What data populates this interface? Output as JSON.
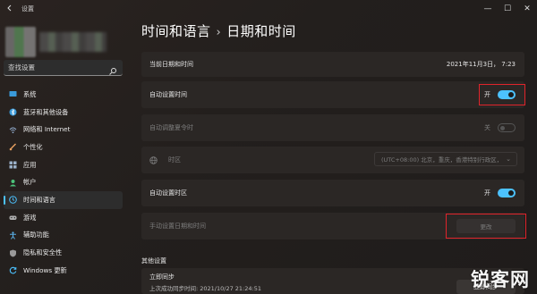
{
  "titlebar": {
    "title": "设置",
    "back_icon": "back-arrow-icon",
    "minimize": "—",
    "maximize": "☐",
    "close": "✕"
  },
  "search": {
    "placeholder": "查找设置"
  },
  "sidebar": {
    "items": [
      {
        "label": "系统",
        "icon": "system-icon",
        "color": "#3a9ad9"
      },
      {
        "label": "蓝牙和其他设备",
        "icon": "bluetooth-icon",
        "color": "#3a9ad9"
      },
      {
        "label": "网络和 Internet",
        "icon": "network-icon",
        "color": "#8fa8c8"
      },
      {
        "label": "个性化",
        "icon": "personalization-icon",
        "color": "#e8a060"
      },
      {
        "label": "应用",
        "icon": "apps-icon",
        "color": "#9ab0c8"
      },
      {
        "label": "帐户",
        "icon": "accounts-icon",
        "color": "#4cc27a"
      },
      {
        "label": "时间和语言",
        "icon": "time-language-icon",
        "color": "#4cc2ff"
      },
      {
        "label": "游戏",
        "icon": "gaming-icon",
        "color": "#b0b0b0"
      },
      {
        "label": "辅助功能",
        "icon": "accessibility-icon",
        "color": "#5ab0e8"
      },
      {
        "label": "隐私和安全性",
        "icon": "privacy-shield-icon",
        "color": "#9a9a9a"
      },
      {
        "label": "Windows 更新",
        "icon": "windows-update-icon",
        "color": "#4cc2ff"
      }
    ],
    "active_index": 6
  },
  "main": {
    "breadcrumb_parent": "时间和语言",
    "breadcrumb_sep": "›",
    "page_title": "日期和时间",
    "current_datetime_label": "当前日期和时间",
    "current_datetime_value": "2021年11月3日，  7:23",
    "auto_time_label": "自动设置时间",
    "auto_time_state": "开",
    "dst_label": "自动调整夏令时",
    "dst_state": "关",
    "timezone_label": "时区",
    "timezone_value": "(UTC+08:00) 北京，重庆，香港特别行政区，",
    "auto_timezone_label": "自动设置时区",
    "auto_timezone_state": "开",
    "manual_label": "手动设置日期和时间",
    "manual_button": "更改",
    "other_settings_label": "其他设置",
    "sync_title": "立即同步",
    "sync_subtitle": "上次成功同步时间: 2021/10/27 21:24:51",
    "sync_button": "立即同步"
  },
  "watermark": "锐客网",
  "colors": {
    "accent": "#4cc2ff",
    "highlight": "#e0242b",
    "card": "#2b2725"
  }
}
